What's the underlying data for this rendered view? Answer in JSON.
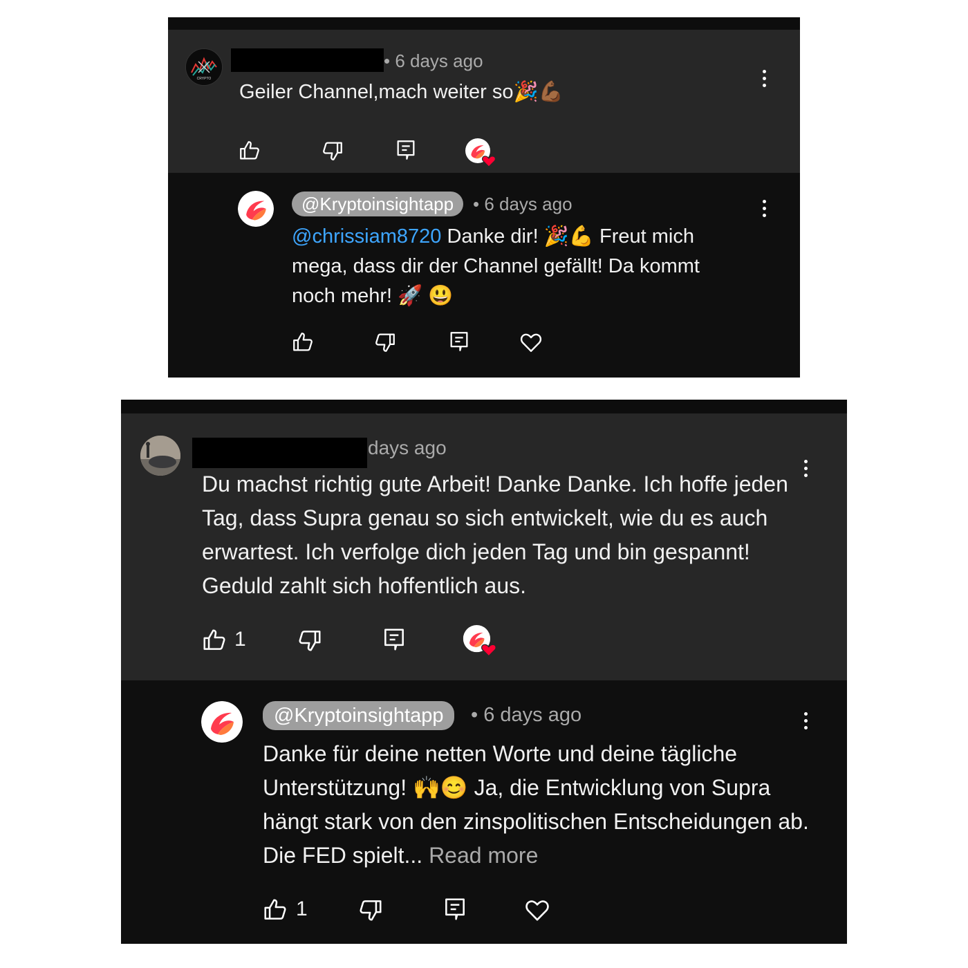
{
  "screenshot_1": {
    "parent": {
      "meta": "• 6 days ago",
      "text": "Geiler Channel,mach weiter so🎉💪🏾",
      "author_avatar_text": "CRYPTO",
      "actions": {
        "like": "like",
        "dislike": "dislike",
        "reply": "reply",
        "creator_heart": "creator-heart"
      }
    },
    "reply": {
      "handle": "@Kryptoinsightapp",
      "meta": "• 6 days ago",
      "mention": "@chrissiam8720",
      "text": " Danke dir! 🎉💪 Freut mich mega, dass dir der Channel gefällt! Da kommt noch mehr! 🚀 😃"
    }
  },
  "screenshot_2": {
    "parent": {
      "meta": "days ago",
      "text": "Du machst richtig gute Arbeit! Danke Danke. Ich hoffe jeden Tag, dass Supra genau so sich entwickelt, wie du es auch erwartest. Ich verfolge dich jeden Tag und bin gespannt! Geduld zahlt sich hoffentlich aus.",
      "like_count": "1"
    },
    "reply": {
      "handle": "@Kryptoinsightapp",
      "meta": "• 6 days ago",
      "text": "Danke für deine netten Worte und deine tägliche Unterstützung! 🙌😊 Ja, die Entwicklung von Supra hängt stark von den zinspolitischen Entscheidungen ab. Die FED spielt... ",
      "read_more": "Read more",
      "like_count": "1"
    }
  },
  "colors": {
    "parent_bg": "#272727",
    "reply_bg": "#0f0f0f",
    "mention": "#3ea6ff",
    "meta": "#aaaaaa",
    "handle_chip": "#9e9e9e",
    "heart_red": "#ff0033"
  }
}
